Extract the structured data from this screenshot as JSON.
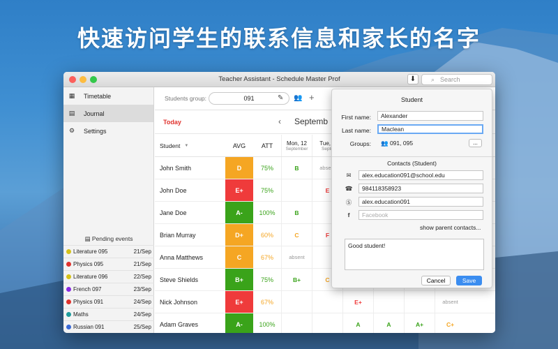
{
  "banner": "快速访问学生的联系信息和家长的名字",
  "window": {
    "title": "Teacher Assistant - Schedule Master Prof",
    "download_icon": "download-icon",
    "search_placeholder": "Search"
  },
  "sidebar": {
    "items": [
      {
        "label": "Timetable",
        "icon": "calendar-icon"
      },
      {
        "label": "Journal",
        "icon": "grid-icon"
      },
      {
        "label": "Settings",
        "icon": "gear-icon"
      }
    ],
    "pending_title": "Pending events",
    "pending": [
      {
        "name": "Literature 095",
        "date": "21/Sep",
        "color": "#d4c21a"
      },
      {
        "name": "Physics 095",
        "date": "21/Sep",
        "color": "#e0322d"
      },
      {
        "name": "Literature 096",
        "date": "22/Sep",
        "color": "#d4c21a"
      },
      {
        "name": "French 097",
        "date": "23/Sep",
        "color": "#8a2be2"
      },
      {
        "name": "Physics 091",
        "date": "24/Sep",
        "color": "#e0322d"
      },
      {
        "name": "Maths",
        "date": "24/Sep",
        "color": "#1e9c9c"
      },
      {
        "name": "Russian 091",
        "date": "25/Sep",
        "color": "#3a6ad6"
      }
    ]
  },
  "toolbar": {
    "group_label": "Students group:",
    "group_value": "091"
  },
  "datebar": {
    "today": "Today",
    "month": "Septemb"
  },
  "table": {
    "headers": {
      "student": "Student",
      "avg": "AVG",
      "att": "ATT",
      "days": [
        {
          "day": "Mon, 12",
          "month": "September"
        },
        {
          "day": "Tue, 1",
          "month": "Septe"
        },
        {
          "day": "",
          "month": ""
        },
        {
          "day": "",
          "month": ""
        },
        {
          "day": "",
          "month": ""
        },
        {
          "day": "",
          "month": ""
        }
      ]
    },
    "rows": [
      {
        "name": "John Smith",
        "avg": "D",
        "avg_color": "#f5a623",
        "att": "75%",
        "att_color": "#3aa31a",
        "marks": [
          "B",
          "absent",
          "",
          "",
          "",
          ""
        ]
      },
      {
        "name": "John Doe",
        "avg": "E+",
        "avg_color": "#ef3b3b",
        "att": "75%",
        "att_color": "#3aa31a",
        "marks": [
          "",
          "E",
          "",
          "",
          "",
          ""
        ]
      },
      {
        "name": "Jane Doe",
        "avg": "A-",
        "avg_color": "#3aa31a",
        "att": "100%",
        "att_color": "#3aa31a",
        "marks": [
          "B",
          "",
          "",
          "",
          "",
          ""
        ]
      },
      {
        "name": "Brian Murray",
        "avg": "D+",
        "avg_color": "#f5a623",
        "att": "60%",
        "att_color": "#f5a623",
        "marks": [
          "C",
          "F",
          "",
          "",
          "",
          ""
        ]
      },
      {
        "name": "Anna Matthews",
        "avg": "C",
        "avg_color": "#f5a623",
        "att": "67%",
        "att_color": "#f5a623",
        "marks": [
          "absent",
          "",
          "",
          "",
          "",
          ""
        ]
      },
      {
        "name": "Steve Shields",
        "avg": "B+",
        "avg_color": "#3aa31a",
        "att": "75%",
        "att_color": "#3aa31a",
        "marks": [
          "B+",
          "C",
          "",
          "",
          "",
          ""
        ]
      },
      {
        "name": "Nick Johnson",
        "avg": "E+",
        "avg_color": "#ef3b3b",
        "att": "67%",
        "att_color": "#f5a623",
        "marks": [
          "",
          "",
          "E+",
          "",
          "",
          "absent"
        ]
      },
      {
        "name": "Adam Graves",
        "avg": "A-",
        "avg_color": "#3aa31a",
        "att": "100%",
        "att_color": "#3aa31a",
        "marks": [
          "",
          "",
          "A",
          "A",
          "A+",
          "C+"
        ]
      }
    ]
  },
  "popover": {
    "title": "Student",
    "first_name_label": "First name:",
    "first_name": "Alexander",
    "last_name_label": "Last name:",
    "last_name": "Maclean",
    "groups_label": "Groups:",
    "groups_value": "091,  095",
    "more_label": "...",
    "contacts_title": "Contacts (Student)",
    "email": "alex.education091@school.edu",
    "phone": "984118358923",
    "skype": "alex.education091",
    "facebook_placeholder": "Facebook",
    "show_parents": "show parent contacts...",
    "notes": "Good student!",
    "cancel": "Cancel",
    "save": "Save"
  }
}
